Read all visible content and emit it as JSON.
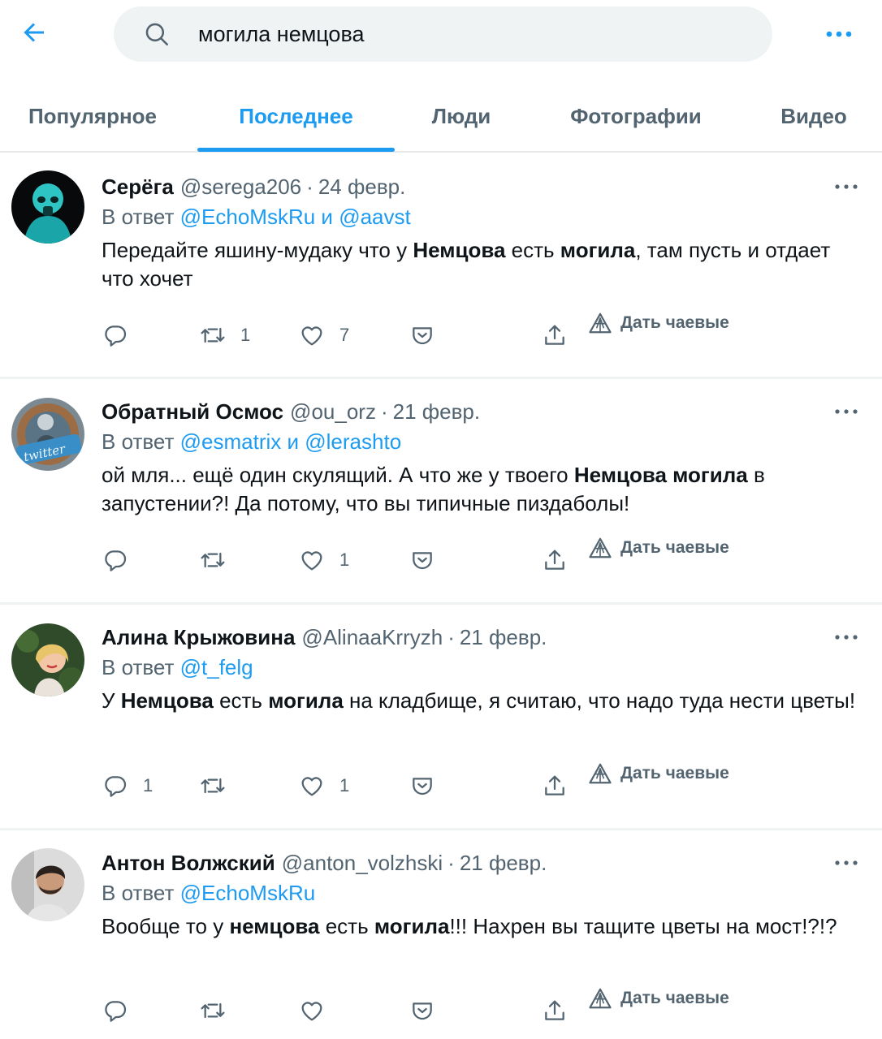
{
  "search": {
    "query": "могила немцова"
  },
  "tabs": [
    {
      "label": "Популярное"
    },
    {
      "label": "Последнее"
    },
    {
      "label": "Люди"
    },
    {
      "label": "Фотографии"
    },
    {
      "label": "Видео"
    }
  ],
  "active_tab": "Последнее",
  "tip_label": "Дать чаевые",
  "reply_prefix": "В ответ",
  "reply_joiner": "и",
  "colors": {
    "accent": "#1d9bf0",
    "text": "#0f1419",
    "secondary": "#536471",
    "search_bg": "#eff3f4"
  },
  "tweets": [
    {
      "name": "Серёга",
      "handle": "@serega206",
      "separator": "·",
      "date": "24 февр.",
      "reply_to": [
        "@EchoMskRu",
        "@aavst"
      ],
      "text": [
        {
          "t": "Передайте яшину-мудаку что у "
        },
        {
          "t": "Немцова",
          "b": true
        },
        {
          "t": " есть "
        },
        {
          "t": "могила",
          "b": true
        },
        {
          "t": ", там пусть и отдает что хочет"
        }
      ],
      "replies": "",
      "retweets": "1",
      "likes": "7"
    },
    {
      "name": "Обратный Осмос",
      "handle": "@ou_orz",
      "separator": "·",
      "date": "21 февр.",
      "reply_to": [
        "@esmatrix",
        "@lerashto"
      ],
      "text": [
        {
          "t": "ой мля... ещё один скулящий. А что же у твоего "
        },
        {
          "t": "Немцова могила",
          "b": true
        },
        {
          "t": " в запустении?! Да потому, что вы типичные пиздаболы!"
        }
      ],
      "replies": "",
      "retweets": "",
      "likes": "1"
    },
    {
      "name": "Алина Крыжовина",
      "handle": "@AlinaaKrryzh",
      "separator": "·",
      "date": "21 февр.",
      "reply_to": [
        "@t_felg"
      ],
      "text": [
        {
          "t": "У "
        },
        {
          "t": "Немцова",
          "b": true
        },
        {
          "t": " есть "
        },
        {
          "t": "могила",
          "b": true
        },
        {
          "t": " на кладбище, я считаю, что надо туда нести цветы!"
        }
      ],
      "replies": "1",
      "retweets": "",
      "likes": "1"
    },
    {
      "name": "Антон Волжский",
      "handle": "@anton_volzhski",
      "separator": "·",
      "date": "21 февр.",
      "reply_to": [
        "@EchoMskRu"
      ],
      "text": [
        {
          "t": "Вообще то у "
        },
        {
          "t": "немцова",
          "b": true
        },
        {
          "t": " есть "
        },
        {
          "t": "могила",
          "b": true
        },
        {
          "t": "!!! Нахрен вы тащите цветы на мост!?!?"
        }
      ],
      "replies": "",
      "retweets": "",
      "likes": ""
    }
  ]
}
